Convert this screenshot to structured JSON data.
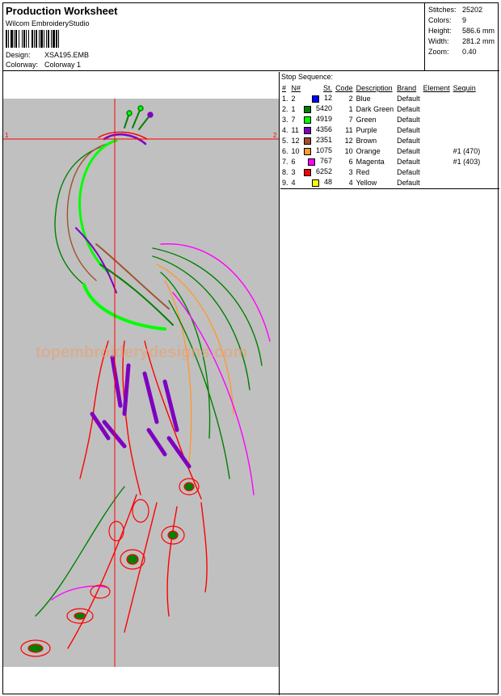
{
  "header": {
    "title": "Production Worksheet",
    "software": "Wilcom EmbroideryStudio",
    "design_label": "Design:",
    "design_value": "XSA195.EMB",
    "colorway_label": "Colorway:",
    "colorway_value": "Colorway 1"
  },
  "stats": [
    {
      "label": "Stitches:",
      "value": "25202"
    },
    {
      "label": "Colors:",
      "value": "9"
    },
    {
      "label": "Height:",
      "value": "586.6 mm"
    },
    {
      "label": "Width:",
      "value": "281.2 mm"
    },
    {
      "label": "Zoom:",
      "value": "0.40"
    }
  ],
  "canvas": {
    "marker_left": "1",
    "marker_right": "2",
    "watermark": "topembroiderydesigns.com",
    "colors": {
      "background": "#c0c0c0",
      "crosshair": "#ff0000"
    }
  },
  "stop_sequence": {
    "title": "Stop Sequence:",
    "columns": [
      "#",
      "N#",
      "St.",
      "Code",
      "Description",
      "Brand",
      "Element",
      "Sequin"
    ],
    "rows": [
      {
        "idx": "1.",
        "n": "2",
        "st": "12",
        "code": "2",
        "color": "#0000ff",
        "desc": "Blue",
        "brand": "Default",
        "element": "",
        "sequin": ""
      },
      {
        "idx": "2.",
        "n": "1",
        "st": "5420",
        "code": "1",
        "color": "#008000",
        "desc": "Dark Green",
        "brand": "Default",
        "element": "",
        "sequin": ""
      },
      {
        "idx": "3.",
        "n": "7",
        "st": "4919",
        "code": "7",
        "color": "#00ff00",
        "desc": "Green",
        "brand": "Default",
        "element": "",
        "sequin": ""
      },
      {
        "idx": "4.",
        "n": "11",
        "st": "4356",
        "code": "11",
        "color": "#8000c0",
        "desc": "Purple",
        "brand": "Default",
        "element": "",
        "sequin": ""
      },
      {
        "idx": "5.",
        "n": "12",
        "st": "2351",
        "code": "12",
        "color": "#a0522d",
        "desc": "Brown",
        "brand": "Default",
        "element": "",
        "sequin": ""
      },
      {
        "idx": "6.",
        "n": "10",
        "st": "1075",
        "code": "10",
        "color": "#ff9933",
        "desc": "Orange",
        "brand": "Default",
        "element": "",
        "sequin": "#1 (470)"
      },
      {
        "idx": "7.",
        "n": "6",
        "st": "767",
        "code": "6",
        "color": "#ff00ff",
        "desc": "Magenta",
        "brand": "Default",
        "element": "",
        "sequin": "#1 (403)"
      },
      {
        "idx": "8.",
        "n": "3",
        "st": "6252",
        "code": "3",
        "color": "#ff0000",
        "desc": "Red",
        "brand": "Default",
        "element": "",
        "sequin": ""
      },
      {
        "idx": "9.",
        "n": "4",
        "st": "48",
        "code": "4",
        "color": "#ffff00",
        "desc": "Yellow",
        "brand": "Default",
        "element": "",
        "sequin": ""
      }
    ]
  }
}
